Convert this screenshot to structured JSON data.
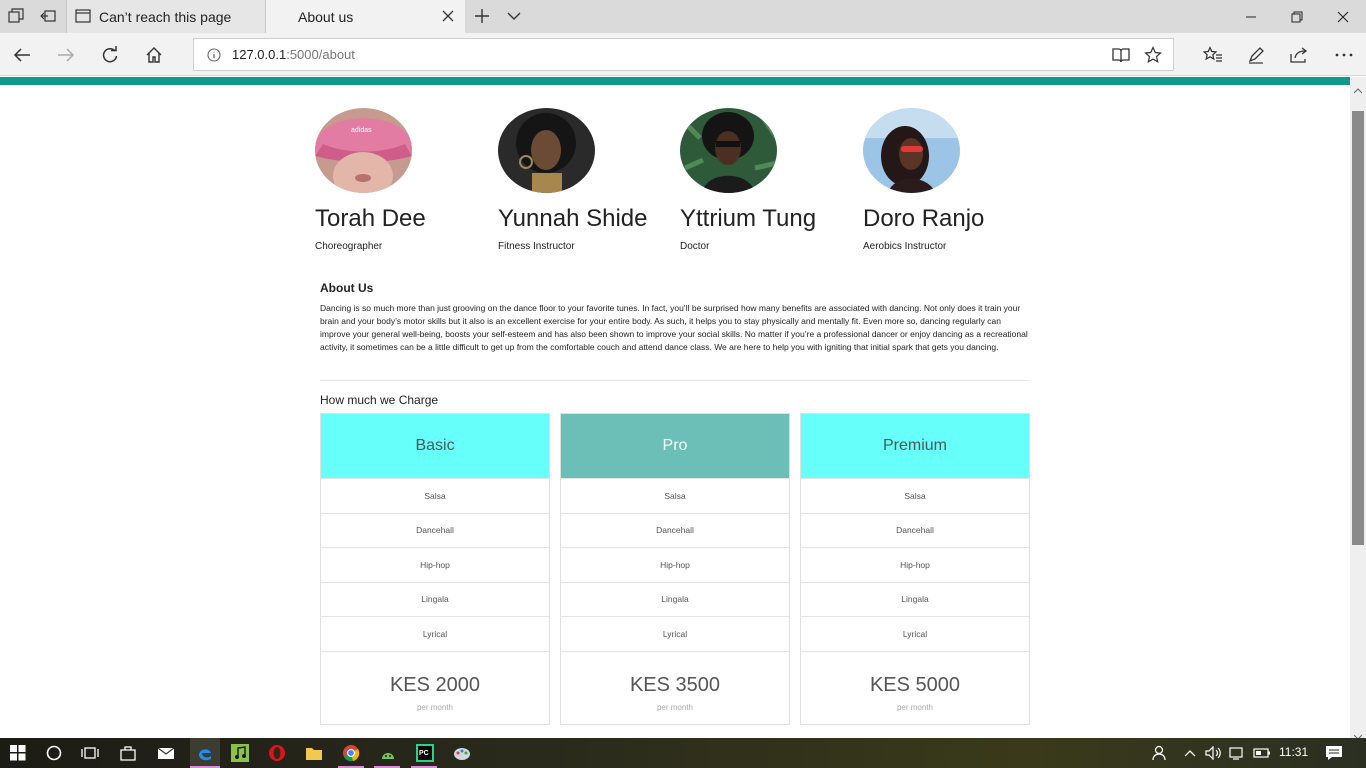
{
  "browser": {
    "tabs": [
      {
        "label": "Can’t reach this page"
      },
      {
        "label": "About us"
      }
    ],
    "url_host": "127.0.0.1",
    "url_path": ":5000/about"
  },
  "team": [
    {
      "name": "Torah Dee",
      "role": "Choreographer"
    },
    {
      "name": "Yunnah Shide",
      "role": "Fitness Instructor"
    },
    {
      "name": "Yttrium Tung",
      "role": "Doctor"
    },
    {
      "name": "Doro Ranjo",
      "role": "Aerobics Instructor"
    }
  ],
  "about": {
    "title": "About Us",
    "text": "Dancing is so much more than just grooving on the dance floor to your favorite tunes. In fact, you’ll be surprised how many benefits are associated with dancing. Not only does it train your brain and your body’s motor skills but it also is an excellent exercise for your entire body. As such, it helps you to stay physically and mentally fit. Even more so, dancing regularly can improve your general well-being, boosts your self-esteem and has also been shown to improve your social skills. No matter if you’re a professional dancer or enjoy dancing as a recreational activity, it sometimes can be a little difficult to get up from the comfortable couch and attend dance class. We are here to help you with igniting that initial spark that gets you dancing."
  },
  "pricing": {
    "title": "How much we Charge",
    "plans": [
      {
        "name": "Basic",
        "styles": [
          "Salsa",
          "Dancehall",
          "Hip-hop",
          "Lingala",
          "Lyrical"
        ],
        "price": "KES 2000",
        "period": "per month",
        "header_color": "#66fff9"
      },
      {
        "name": "Pro",
        "styles": [
          "Salsa",
          "Dancehall",
          "Hip-hop",
          "Lingala",
          "Lyrical"
        ],
        "price": "KES 3500",
        "period": "per month",
        "header_color": "#6bbfb6"
      },
      {
        "name": "Premium",
        "styles": [
          "Salsa",
          "Dancehall",
          "Hip-hop",
          "Lingala",
          "Lyrical"
        ],
        "price": "KES 5000",
        "period": "per month",
        "header_color": "#66fff9"
      }
    ]
  },
  "taskbar": {
    "clock": "11:31"
  },
  "colors": {
    "accent": "#0f9a8b"
  }
}
